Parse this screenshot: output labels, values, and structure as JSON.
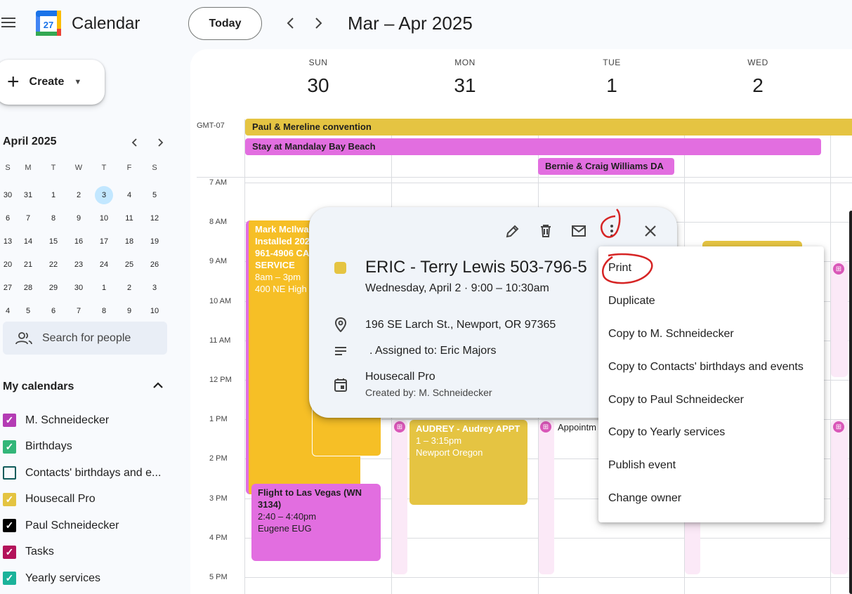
{
  "header": {
    "app_title": "Calendar",
    "logo_day": "27",
    "today_label": "Today",
    "prev_icon": "chevron-left-icon",
    "next_icon": "chevron-right-icon",
    "date_range": "Mar – Apr 2025"
  },
  "sidebar": {
    "create_label": "Create",
    "mini_calendar": {
      "month_label": "April 2025",
      "weekdays": [
        "S",
        "M",
        "T",
        "W",
        "T",
        "F",
        "S"
      ],
      "weeks": [
        [
          "30",
          "31",
          "1",
          "2",
          "3",
          "4",
          "5"
        ],
        [
          "6",
          "7",
          "8",
          "9",
          "10",
          "11",
          "12"
        ],
        [
          "13",
          "14",
          "15",
          "16",
          "17",
          "18",
          "19"
        ],
        [
          "20",
          "21",
          "22",
          "23",
          "24",
          "25",
          "26"
        ],
        [
          "27",
          "28",
          "29",
          "30",
          "1",
          "2",
          "3"
        ],
        [
          "4",
          "5",
          "6",
          "7",
          "8",
          "9",
          "10"
        ]
      ],
      "today": "3"
    },
    "search_people_placeholder": "Search for people",
    "my_calendars_title": "My calendars",
    "calendars": [
      {
        "name": "M. Schneidecker",
        "color": "#b43cb4",
        "checked": true
      },
      {
        "name": "Birthdays",
        "color": "#33b679",
        "checked": true
      },
      {
        "name": "Contacts' birthdays and e...",
        "color": "#0f5b5b",
        "checked": false
      },
      {
        "name": "Housecall Pro",
        "color": "#e4c441",
        "checked": true
      },
      {
        "name": "Paul Schneidecker",
        "color": "#000000",
        "checked": true
      },
      {
        "name": "Tasks",
        "color": "#b3125a",
        "checked": true
      },
      {
        "name": "Yearly services",
        "color": "#1bb39a",
        "checked": true
      }
    ]
  },
  "grid": {
    "timezone": "GMT-07",
    "days": [
      {
        "dow": "SUN",
        "num": "30"
      },
      {
        "dow": "MON",
        "num": "31"
      },
      {
        "dow": "TUE",
        "num": "1"
      },
      {
        "dow": "WED",
        "num": "2"
      }
    ],
    "hours": [
      "7 AM",
      "8 AM",
      "9 AM",
      "10 AM",
      "11 AM",
      "12 PM",
      "1 PM",
      "2 PM",
      "3 PM",
      "4 PM",
      "5 PM"
    ],
    "all_day_events": [
      {
        "title": "Paul & Mereline convention",
        "color": "#e5c442"
      },
      {
        "title": "Stay at Mandalay Bay Beach",
        "color": "#e26ee0"
      },
      {
        "title": "Bernie & Craig Williams DA",
        "color": "#e26ee0"
      }
    ],
    "events": {
      "mark": {
        "title": "Mark McIlwa",
        "lines": [
          "Installed 202",
          "961-4906 CA",
          "SERVICE",
          "8am – 3pm",
          "400 NE High"
        ]
      },
      "flight": {
        "title": "Flight to Las Vegas (WN 3134)",
        "time": "2:40 – 4:40pm",
        "place": "Eugene EUG"
      },
      "audrey": {
        "title": "AUDREY - Audrey APPT",
        "time": "1 – 3:15pm",
        "place": "Newport Oregon"
      },
      "appointment": {
        "title": "Appointm"
      }
    },
    "task_glyph": "⊞"
  },
  "popup": {
    "edit_icon": "pencil-icon",
    "delete_icon": "trash-icon",
    "email_icon": "email-icon",
    "more_icon": "more-vert-icon",
    "close_icon": "close-icon",
    "title": "ERIC - Terry Lewis 503-796-5",
    "when": "Wednesday, April 2  ·  9:00 – 10:30am",
    "location": "196 SE Larch St., Newport, OR 97365",
    "description": ". Assigned to: Eric Majors",
    "calendar": "Housecall Pro",
    "created_by": "Created by: M. Schneidecker"
  },
  "menu": {
    "items": [
      "Print",
      "Duplicate",
      "Copy to M. Schneidecker",
      "Copy to Contacts' birthdays and events",
      "Copy to Paul Schneidecker",
      "Copy to Yearly services",
      "Publish event",
      "Change owner"
    ]
  }
}
